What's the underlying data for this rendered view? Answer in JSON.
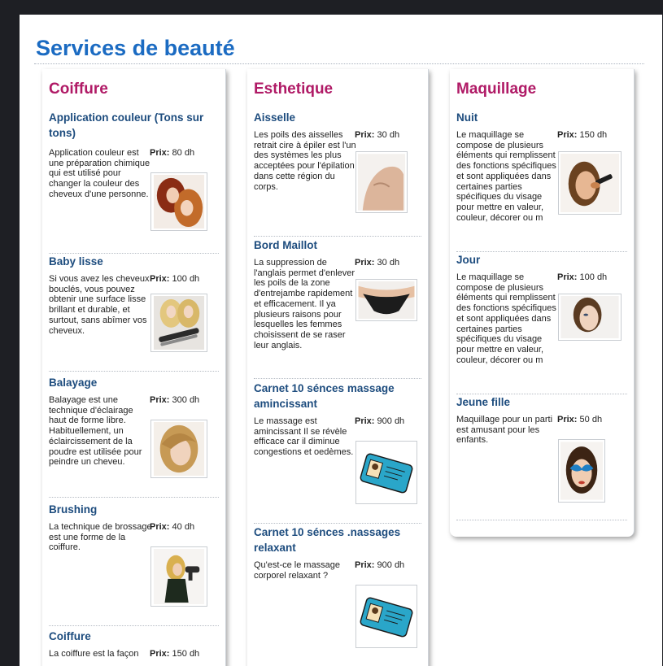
{
  "page": {
    "title": "Services de beauté"
  },
  "columns": [
    {
      "title": "Coiffure",
      "services": [
        {
          "name": "Application couleur (Tons sur tons)",
          "description": "Application couleur est une préparation chimique qui est utilisé pour changer la couleur des cheveux d'une personne.",
          "price_label": "Prix:",
          "price": "80 dh",
          "image": "woman-hair-color-photo"
        },
        {
          "name": "Baby lisse",
          "description": "Si vous avez les cheveux bouclés, vous pouvez obtenir une surface lisse brillant et durable, et surtout, sans abîmer vos cheveux.",
          "price_label": "Prix:",
          "price": "100 dh",
          "image": "hair-straightener-photo"
        },
        {
          "name": "Balayage",
          "description": "Balayage est une technique d'éclairage haut de forme libre. Habituellement, un éclaircissement de la poudre est utilisée pour peindre un cheveu.",
          "price_label": "Prix:",
          "price": "300 dh",
          "image": "blonde-woman-photo"
        },
        {
          "name": "Brushing",
          "description": "La technique de brossage est une forme de la coiffure.",
          "price_label": "Prix:",
          "price": "40 dh",
          "image": "woman-hairdryer-photo"
        },
        {
          "name": "Coiffure",
          "description": "La coiffure est la façon",
          "price_label": "Prix:",
          "price": "150 dh",
          "image": ""
        }
      ]
    },
    {
      "title": "Esthetique",
      "services": [
        {
          "name": "Aisselle",
          "description": "Les poils des aisselles retrait cire à épiler est l'un des systèmes les plus acceptées pour l'épilation dans cette région du corps.",
          "price_label": "Prix:",
          "price": "30 dh",
          "image": "shoulder-photo"
        },
        {
          "name": "Bord Maillot",
          "description": "La suppression de l'anglais permet d'enlever les poils de la zone d'entrejambe rapidement et efficacement. Il ya plusieurs raisons pour lesquelles les femmes choisissent de se raser leur anglais.",
          "price_label": "Prix:",
          "price": "30 dh",
          "image": "bikini-photo"
        },
        {
          "name": "Carnet 10 sénces massage amincissant",
          "description": "Le massage est amincissant Il se révèle efficace car il diminue congestions et oedèmes.",
          "price_label": "Prix:",
          "price": "900 dh",
          "image": "id-card-icon"
        },
        {
          "name": "Carnet 10 sénces .nassages relaxant",
          "description": "Qu'est-ce le massage corporel relaxant ?",
          "price_label": "Prix:",
          "price": "900 dh",
          "image": "id-card-icon"
        }
      ]
    },
    {
      "title": "Maquillage",
      "services": [
        {
          "name": "Nuit",
          "description": "Le maquillage se compose de plusieurs éléments qui remplissent des fonctions spécifiques et sont appliquées dans certaines parties spécifiques du visage pour mettre en valeur, couleur, décorer ou m",
          "price_label": "Prix:",
          "price": "150 dh",
          "image": "makeup-brush-photo"
        },
        {
          "name": "Jour",
          "description": "Le maquillage se compose de plusieurs éléments qui remplissent des fonctions spécifiques et sont appliquées dans certaines parties spécifiques du visage pour mettre en valeur, couleur, décorer ou m",
          "price_label": "Prix:",
          "price": "100 dh",
          "image": "woman-face-photo"
        },
        {
          "name": "Jeune fille",
          "description": "Maquillage pour un parti est amusant pour les enfants.",
          "price_label": "Prix:",
          "price": "50 dh",
          "image": "face-paint-photo"
        }
      ]
    }
  ]
}
